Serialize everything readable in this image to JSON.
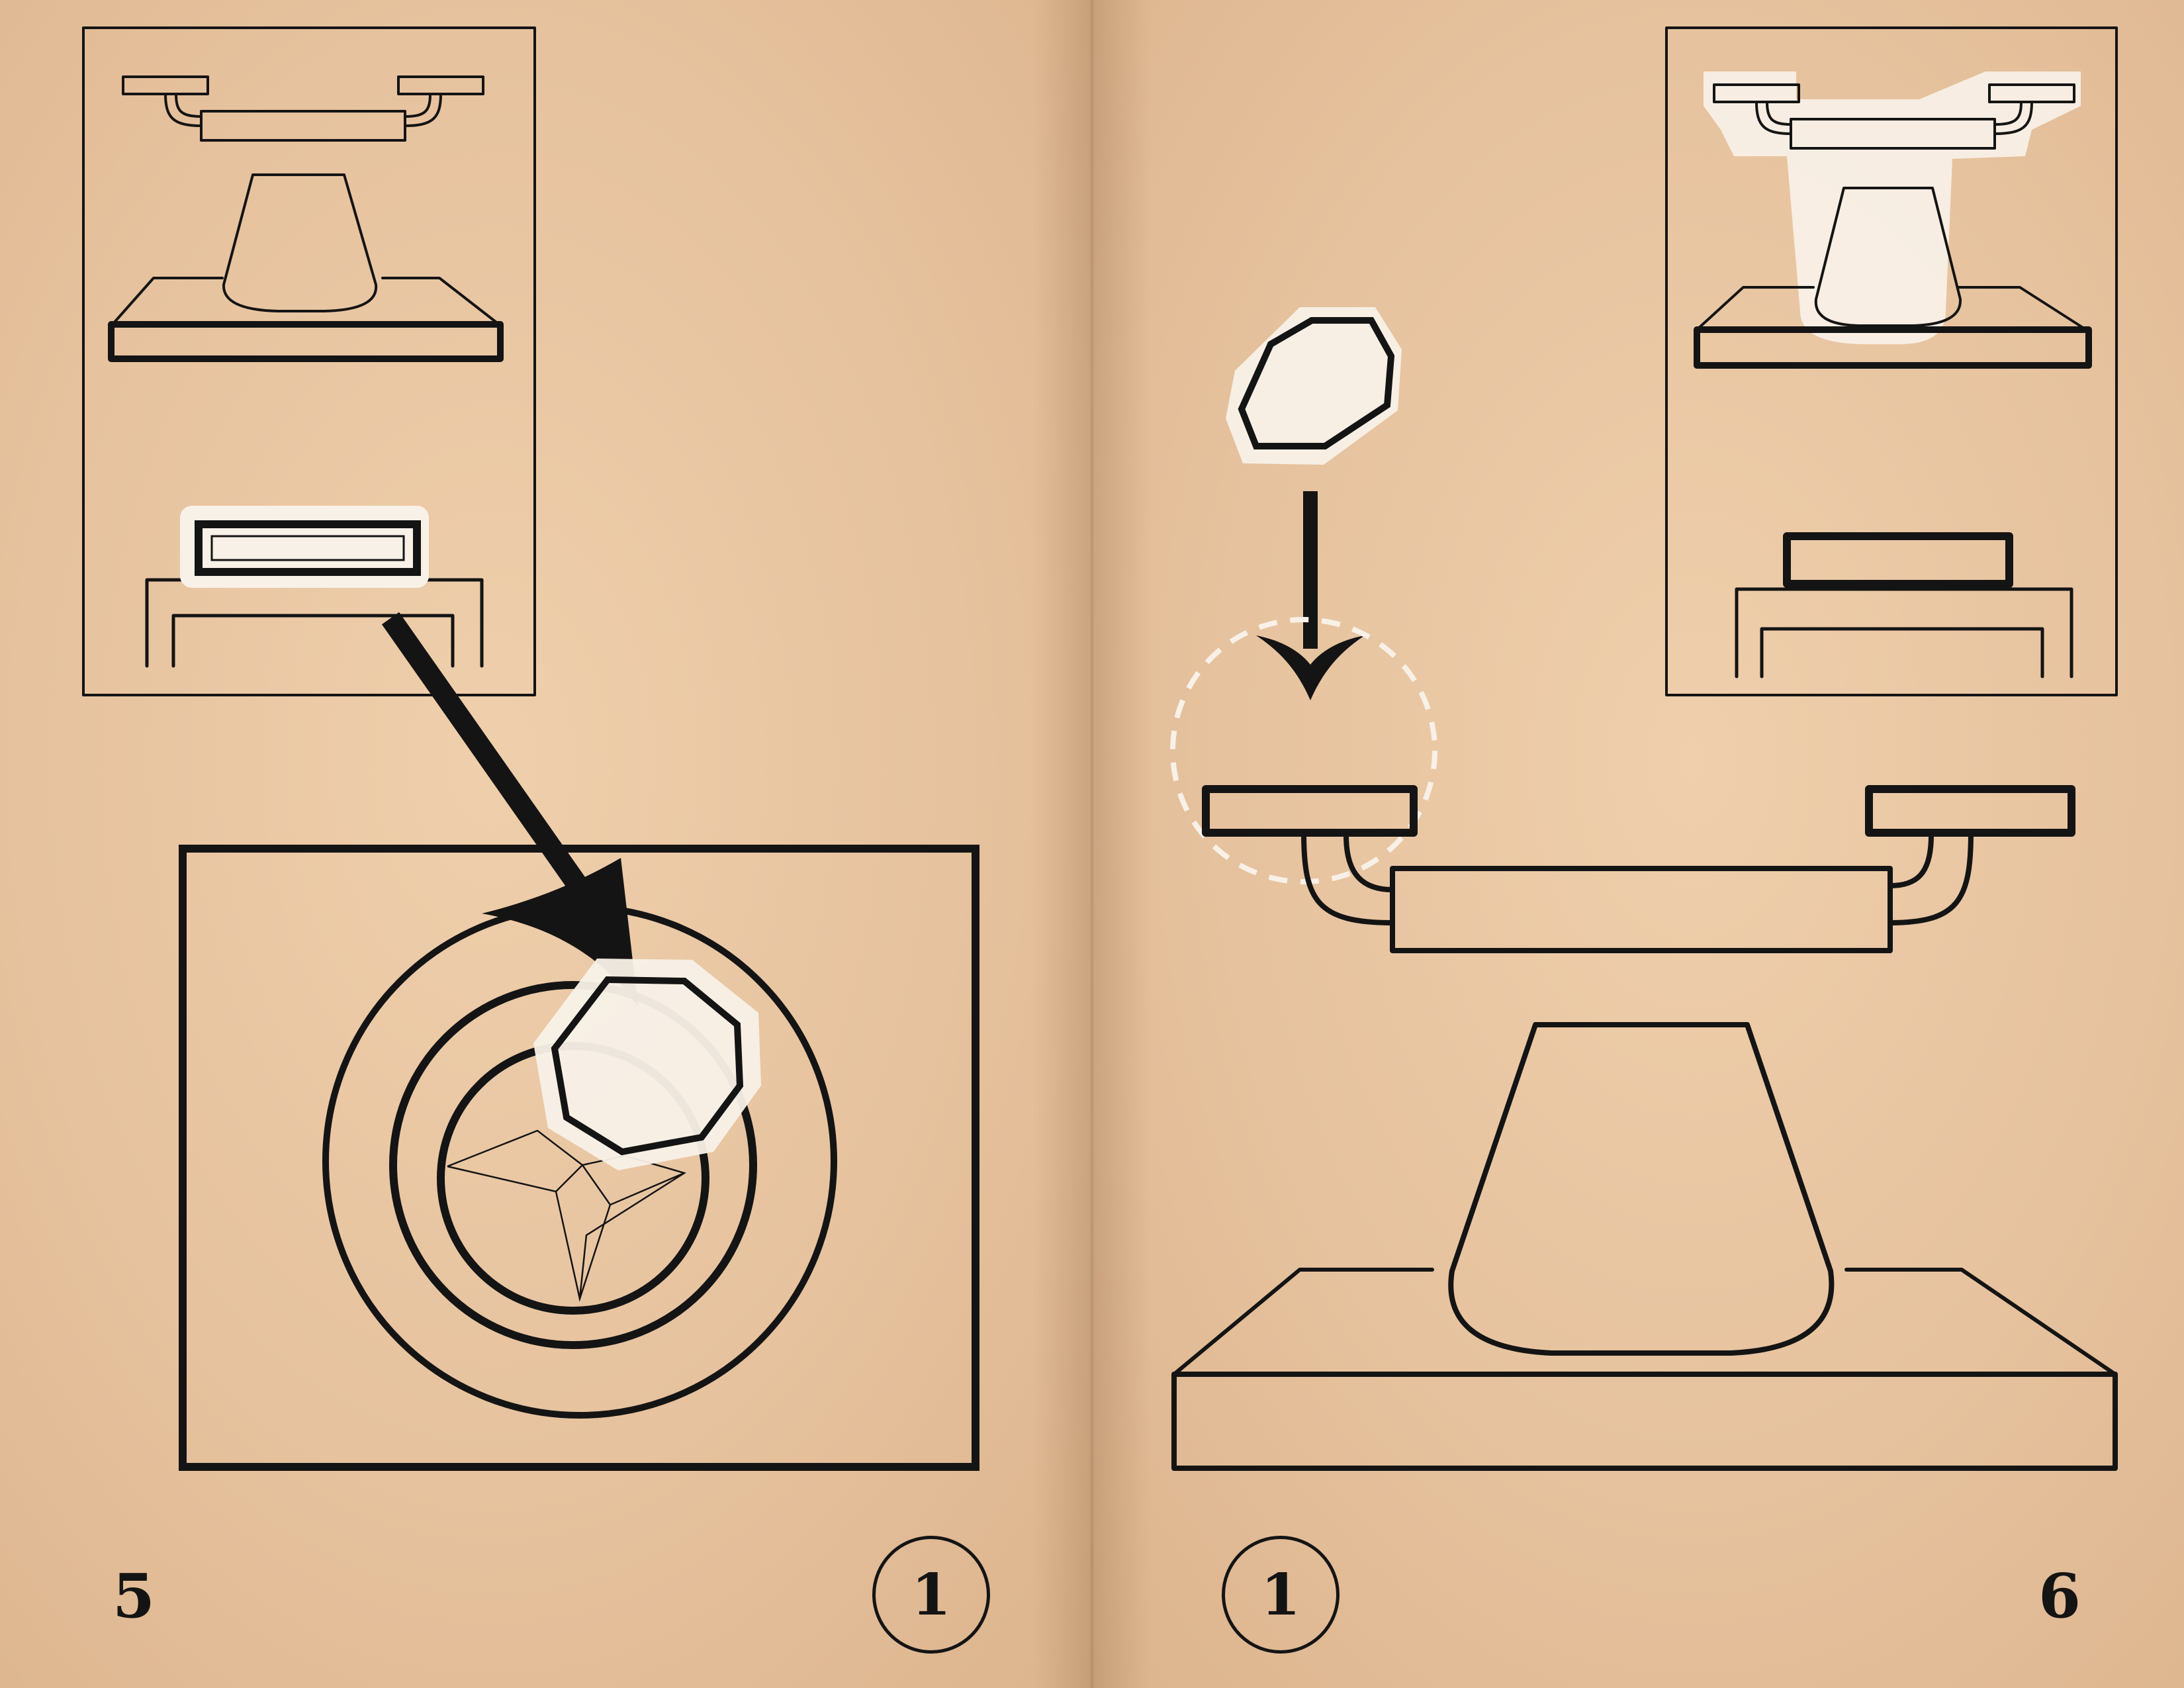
{
  "pages": {
    "left": {
      "number": "5",
      "step": "1"
    },
    "right": {
      "number": "6",
      "step": "1"
    }
  },
  "colors": {
    "paper": "#e5c4a0",
    "ink": "#141414",
    "highlight": "#f8f1e8"
  },
  "icons": {
    "arrow": "down-arrow-icon",
    "part": "octagon-gem-icon"
  }
}
